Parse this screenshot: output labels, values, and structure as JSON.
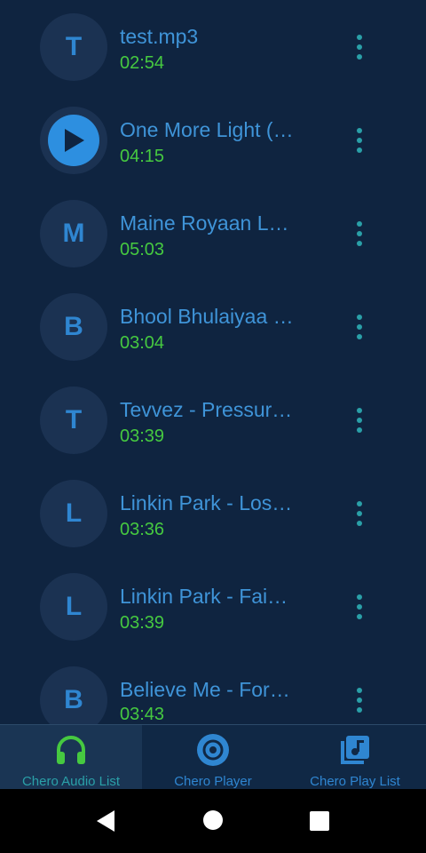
{
  "tracks": [
    {
      "letter": "T",
      "title": "test.mp3",
      "duration": "02:54",
      "playing": false
    },
    {
      "letter": "",
      "title": "One More Light (…",
      "duration": "04:15",
      "playing": true
    },
    {
      "letter": "M",
      "title": "Maine Royaan L…",
      "duration": "05:03",
      "playing": false
    },
    {
      "letter": "B",
      "title": "Bhool Bhulaiyaa …",
      "duration": "03:04",
      "playing": false
    },
    {
      "letter": "T",
      "title": "Tevvez - Pressur…",
      "duration": "03:39",
      "playing": false
    },
    {
      "letter": "L",
      "title": "Linkin Park - Los…",
      "duration": "03:36",
      "playing": false
    },
    {
      "letter": "L",
      "title": "Linkin Park - Fai…",
      "duration": "03:39",
      "playing": false
    },
    {
      "letter": "B",
      "title": "Believe Me - For…",
      "duration": "03:43",
      "playing": false
    }
  ],
  "bottom_nav": [
    {
      "label": "Chero Audio List",
      "icon": "headphones-icon",
      "active": true
    },
    {
      "label": "Chero Player",
      "icon": "disc-icon",
      "active": false
    },
    {
      "label": "Chero Play List",
      "icon": "music-library-icon",
      "active": false
    }
  ],
  "system_nav": {
    "back": "back-icon",
    "home": "home-icon",
    "recents": "recents-icon"
  },
  "colors": {
    "background": "#0f2440",
    "accent_blue": "#2f86d1",
    "duration_green": "#46c940",
    "menu_teal": "#2aa0a8"
  }
}
